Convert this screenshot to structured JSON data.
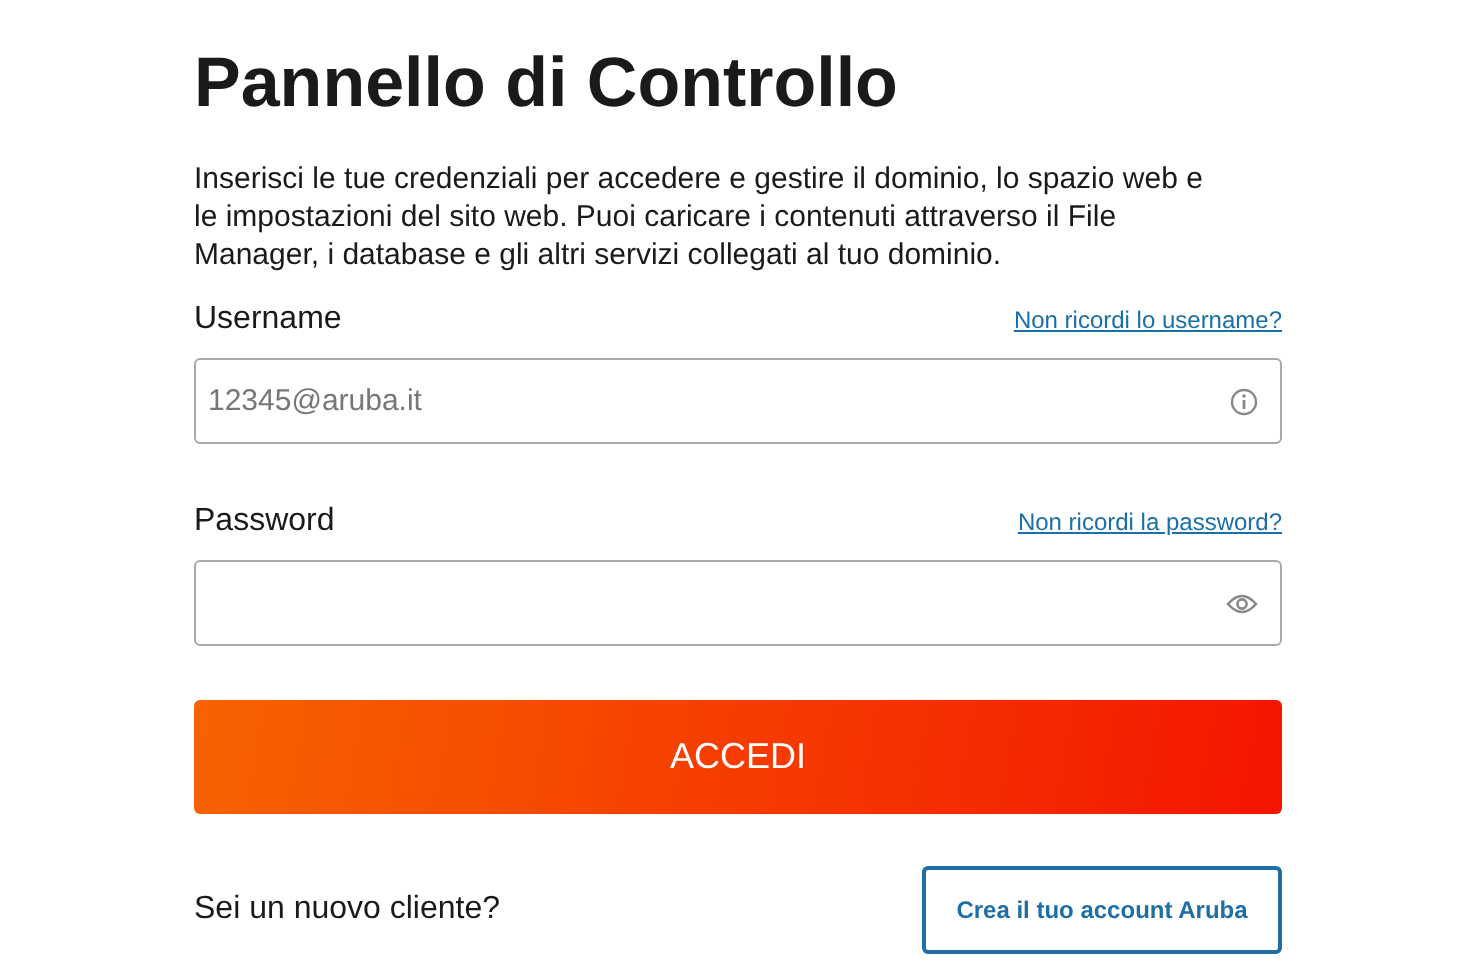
{
  "title": "Pannello di Controllo",
  "intro": "Inserisci le tue credenziali per accedere e gestire il dominio, lo spazio web e le impostazioni del sito web. Puoi caricare i contenuti attraverso il File Manager, i database e gli altri servizi collegati al tuo dominio.",
  "fields": [
    {
      "kind": "text",
      "label": "Username",
      "help_link": "Non ricordi lo username?",
      "placeholder": "12345@aruba.it"
    },
    {
      "kind": "password",
      "label": "Password",
      "help_link": "Non ricordi la password?"
    }
  ],
  "submit": "ACCEDI",
  "signup": {
    "question": "Sei un nuovo cliente?",
    "button": "Crea il tuo account Aruba"
  }
}
